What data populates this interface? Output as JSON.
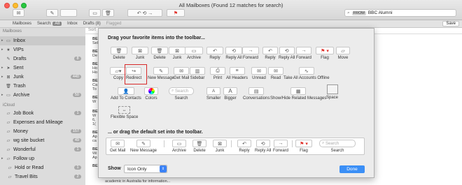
{
  "window": {
    "title": "All Mailboxes (Found 12 matches for search)"
  },
  "search": {
    "token": "FROM",
    "query": "BBC Alumni"
  },
  "favorites_bar": {
    "mailboxes": "Mailboxes",
    "search_label": "Search:",
    "all": "All",
    "inbox": "Inbox",
    "drafts": "Drafts (8)",
    "flagged": "Flagged",
    "save": "Save"
  },
  "sidebar": {
    "mailboxes_header": "Mailboxes",
    "icloud_header": "iCloud",
    "mailbox_items": [
      {
        "label": "Inbox",
        "badge": ""
      },
      {
        "label": "VIPs",
        "badge": ""
      },
      {
        "label": "Drafts",
        "badge": "8"
      },
      {
        "label": "Sent",
        "badge": ""
      },
      {
        "label": "Junk",
        "badge": "440"
      },
      {
        "label": "Trash",
        "badge": ""
      },
      {
        "label": "Archive",
        "badge": "50"
      }
    ],
    "icloud_items": [
      {
        "label": "Job Book",
        "badge": "1"
      },
      {
        "label": "Expenses and Mileage",
        "badge": ""
      },
      {
        "label": "Money",
        "badge": "157"
      },
      {
        "label": "wg site bucket",
        "badge": "49"
      },
      {
        "label": "Wonderful",
        "badge": "1"
      },
      {
        "label": "Follow up",
        "badge": ""
      },
      {
        "label": "Hold or Read",
        "badge": "1"
      },
      {
        "label": "Travel Bits",
        "badge": "2"
      }
    ]
  },
  "message_list": {
    "sort_label": "Sort",
    "fragments": [
      "BE",
      "Sel",
      "BE",
      "De",
      "BE",
      "Ho",
      "Ho",
      "BE",
      "Ca",
      "To",
      "BE",
      "W",
      "BE",
      "W",
      "6,",
      "1(",
      "BE",
      "Ap",
      "ca",
      "BE",
      "Wi",
      "Ap",
      "BE"
    ],
    "bottom_text": "academic in Australia for information..."
  },
  "sheet": {
    "title": "Drag your favorite items into the toolbar...",
    "default_title": "... or drag the default set into the toolbar.",
    "show_label": "Show",
    "show_value": "Icon Only",
    "done": "Done",
    "row1": [
      "Delete",
      "Junk",
      "Delete",
      "Junk",
      "Archive",
      "Reply",
      "Reply All",
      "Forward",
      "Reply",
      "Reply All",
      "Forward",
      "Flag",
      "Move"
    ],
    "row2": [
      "Copy",
      "Redirect",
      "New Message",
      "Get Mail",
      "Sidebar",
      "Print",
      "All Headers",
      "Unread",
      "Read",
      "Take All Accounts Offline"
    ],
    "row3": [
      "Add To Contacts",
      "Colors",
      "Search",
      "Smaller",
      "Bigger",
      "Conversations",
      "Show/Hide Related Messages",
      "Space"
    ],
    "row4": [
      "Flexible Space"
    ],
    "search_placeholder": "Search",
    "default_items": [
      "Get Mail",
      "New Message",
      "Archive",
      "Delete",
      "Junk",
      "Reply",
      "Reply All",
      "Forward",
      "Flag",
      "Search"
    ]
  },
  "colors": {
    "accent": "#3b8ff6",
    "highlight_box": "#d72a2a",
    "flag": "#e0302a"
  }
}
